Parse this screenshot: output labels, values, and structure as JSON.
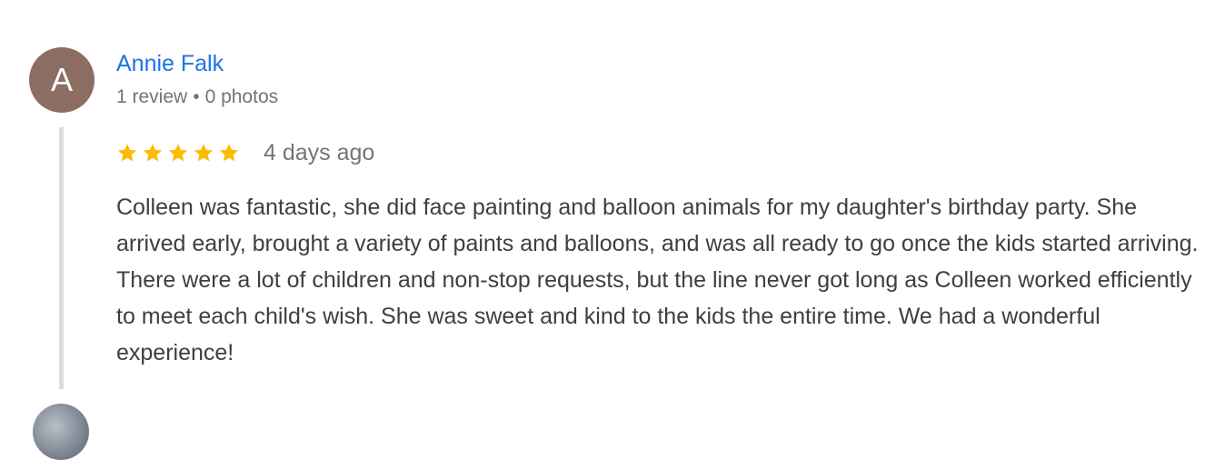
{
  "review": {
    "avatar_initial": "A",
    "avatar_color": "#8d6e63",
    "author_name": "Annie Falk",
    "review_count": "1 review",
    "separator": "•",
    "photo_count": "0 photos",
    "rating": 5,
    "rating_max": 5,
    "star_color": "#fbbc04",
    "date": "4 days ago",
    "text": "Colleen was fantastic, she did face painting and balloon animals for my daughter's birthday party. She arrived early, brought a variety of paints and balloons, and was all ready to go once the kids started arriving. There were a lot of children and non-stop requests, but the line never got long as Colleen worked efficiently to meet each child's wish. She was sweet and kind to the kids the entire time. We had a wonderful experience!"
  },
  "colors": {
    "link": "#1a73e8",
    "meta": "#70757a",
    "body_text": "#3c4043",
    "thread_line": "#dadce0"
  }
}
